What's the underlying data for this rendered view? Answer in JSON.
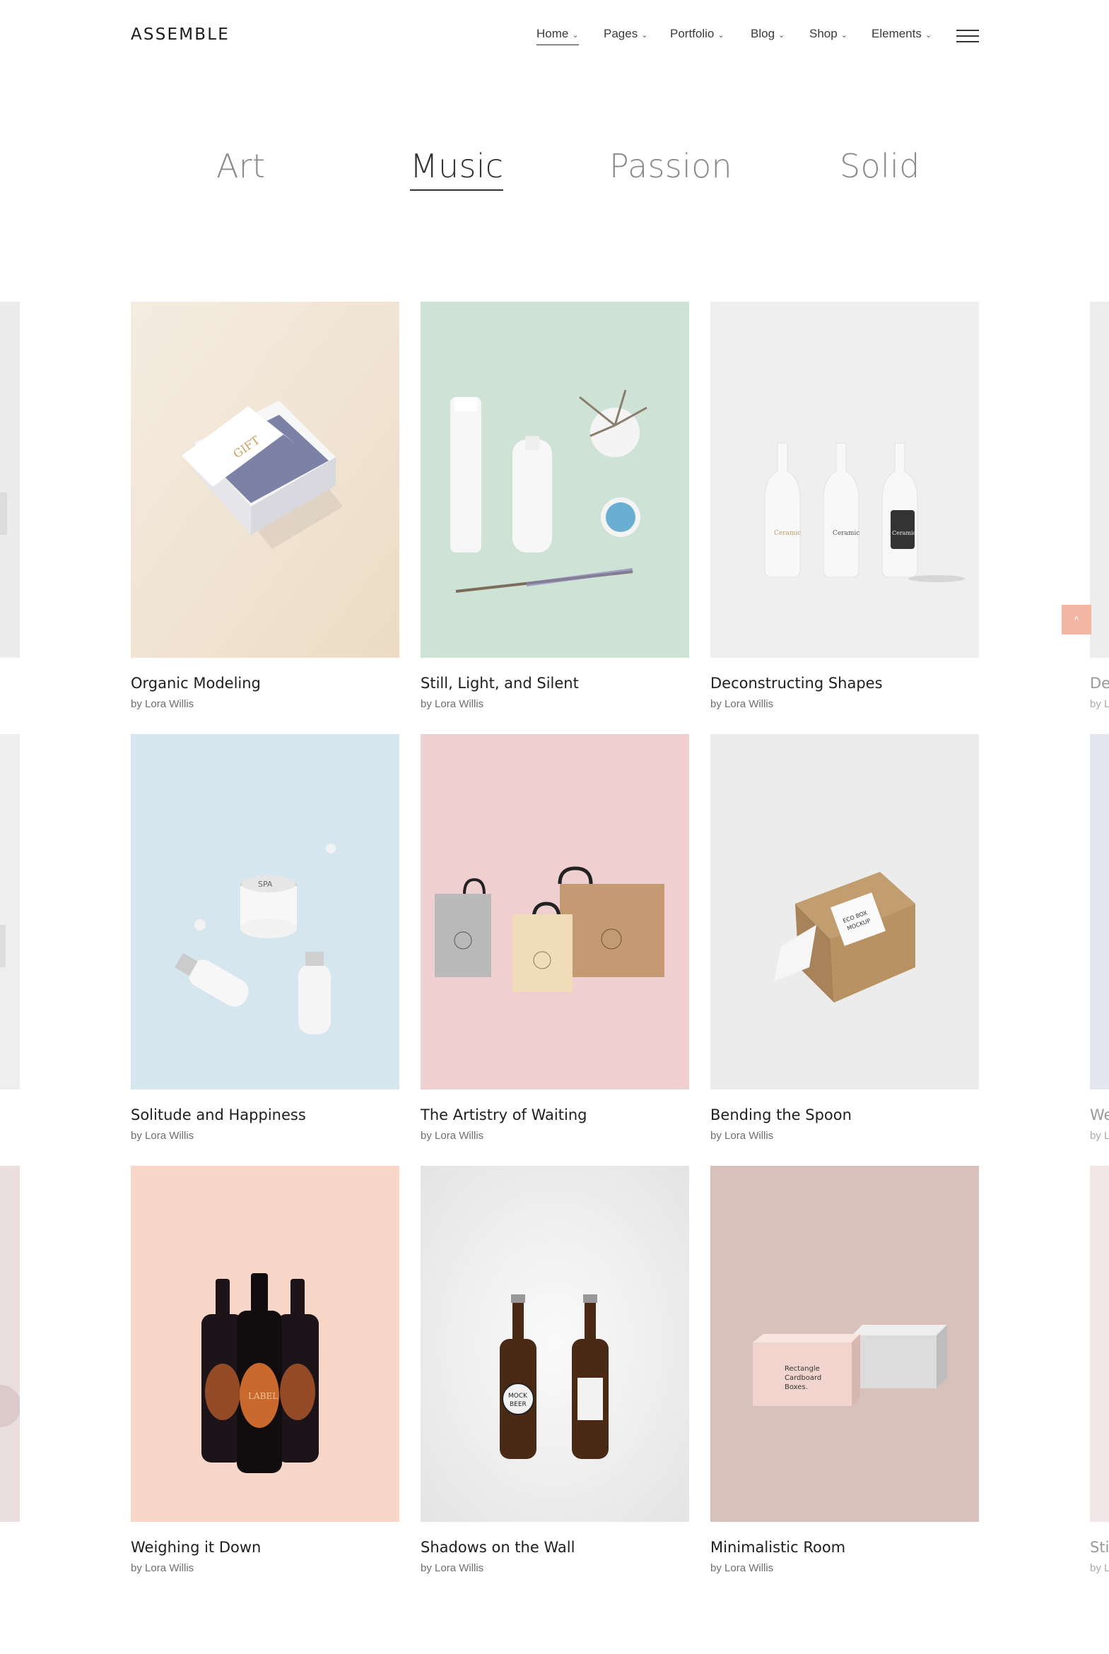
{
  "brand": {
    "logo": "ASSEMBLE"
  },
  "nav": {
    "items": [
      {
        "label": "Home",
        "active": true
      },
      {
        "label": "Pages",
        "active": false
      },
      {
        "label": "Portfolio",
        "active": false
      },
      {
        "label": "Blog",
        "active": false
      },
      {
        "label": "Shop",
        "active": false
      },
      {
        "label": "Elements",
        "active": false
      }
    ],
    "chevron": "⌄",
    "menu_icon": "hamburger-menu-icon"
  },
  "filters": {
    "items": [
      {
        "label": "Art",
        "active": false
      },
      {
        "label": "Music",
        "active": true
      },
      {
        "label": "Passion",
        "active": false
      },
      {
        "label": "Solid",
        "active": false
      }
    ]
  },
  "portfolio": {
    "items": [
      {
        "title": "Organic Modeling",
        "author": "by Lora Willis",
        "bg": "#f2e6d6",
        "image": "gift-box-mockup"
      },
      {
        "title": "Still, Light, and Silent",
        "author": "by Lora Willis",
        "bg": "#cfe2d6",
        "image": "spa-products-mockup"
      },
      {
        "title": "Deconstructing Shapes",
        "author": "by Lora Willis",
        "bg": "#efefef",
        "image": "ceramic-bottles-mockup"
      },
      {
        "title": "Solitude and Happiness",
        "author": "by Lora Willis",
        "bg": "#d6e6ef",
        "image": "spa-jars-mockup"
      },
      {
        "title": "The Artistry of Waiting",
        "author": "by Lora Willis",
        "bg": "#efcfcf",
        "image": "shopping-bags-mockup"
      },
      {
        "title": "Bending the Spoon",
        "author": "by Lora Willis",
        "bg": "#ececec",
        "image": "eco-box-mockup"
      },
      {
        "title": "Weighing it Down",
        "author": "by Lora Willis",
        "bg": "#f9d7c8",
        "image": "wine-bottles-mockup"
      },
      {
        "title": "Shadows on the Wall",
        "author": "by Lora Willis",
        "bg": "#ececec",
        "image": "beer-bottles-mockup"
      },
      {
        "title": "Minimalistic Room",
        "author": "by Lora Willis",
        "bg": "#d9c1bb",
        "image": "cardboard-boxes-mockup"
      }
    ],
    "peek_right": [
      {
        "title_fragment": "De",
        "author_fragment": "by L"
      },
      {
        "title_fragment": "We",
        "author_fragment": "by L"
      },
      {
        "title_fragment": "Stil",
        "author_fragment": "by L"
      }
    ]
  },
  "scroll_top": {
    "icon": "chevron-up-icon",
    "glyph": "^",
    "color": "#f2b6a2"
  }
}
